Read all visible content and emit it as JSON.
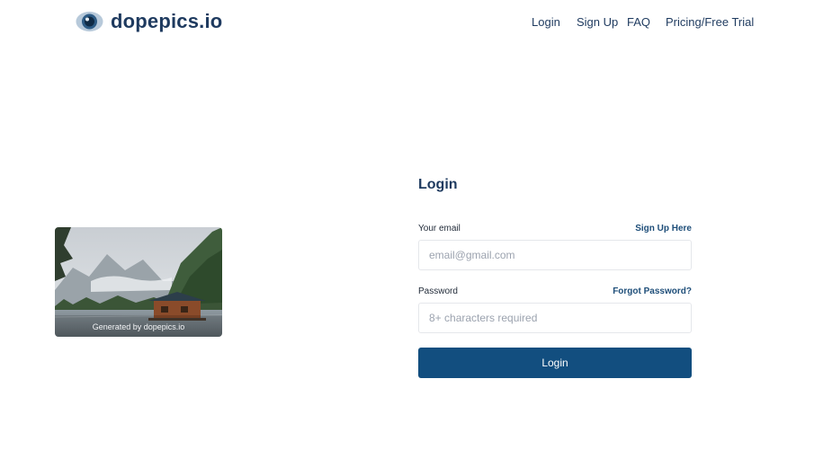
{
  "brand": {
    "name": "dopepics.io",
    "icon": "eye-logo-icon"
  },
  "nav": {
    "login": "Login",
    "signup": "Sign Up",
    "faq": "FAQ",
    "pricing": "Pricing/Free Trial"
  },
  "image_card": {
    "caption": "Generated by dopepics.io"
  },
  "form": {
    "title": "Login",
    "email_label": "Your email",
    "signup_link": "Sign Up Here",
    "email_placeholder": "email@gmail.com",
    "password_label": "Password",
    "forgot_link": "Forgot Password?",
    "password_placeholder": "8+ characters required",
    "submit_label": "Login"
  },
  "colors": {
    "brand": "#1e3a5f",
    "button": "#124e7f",
    "link": "#1e4e79"
  }
}
